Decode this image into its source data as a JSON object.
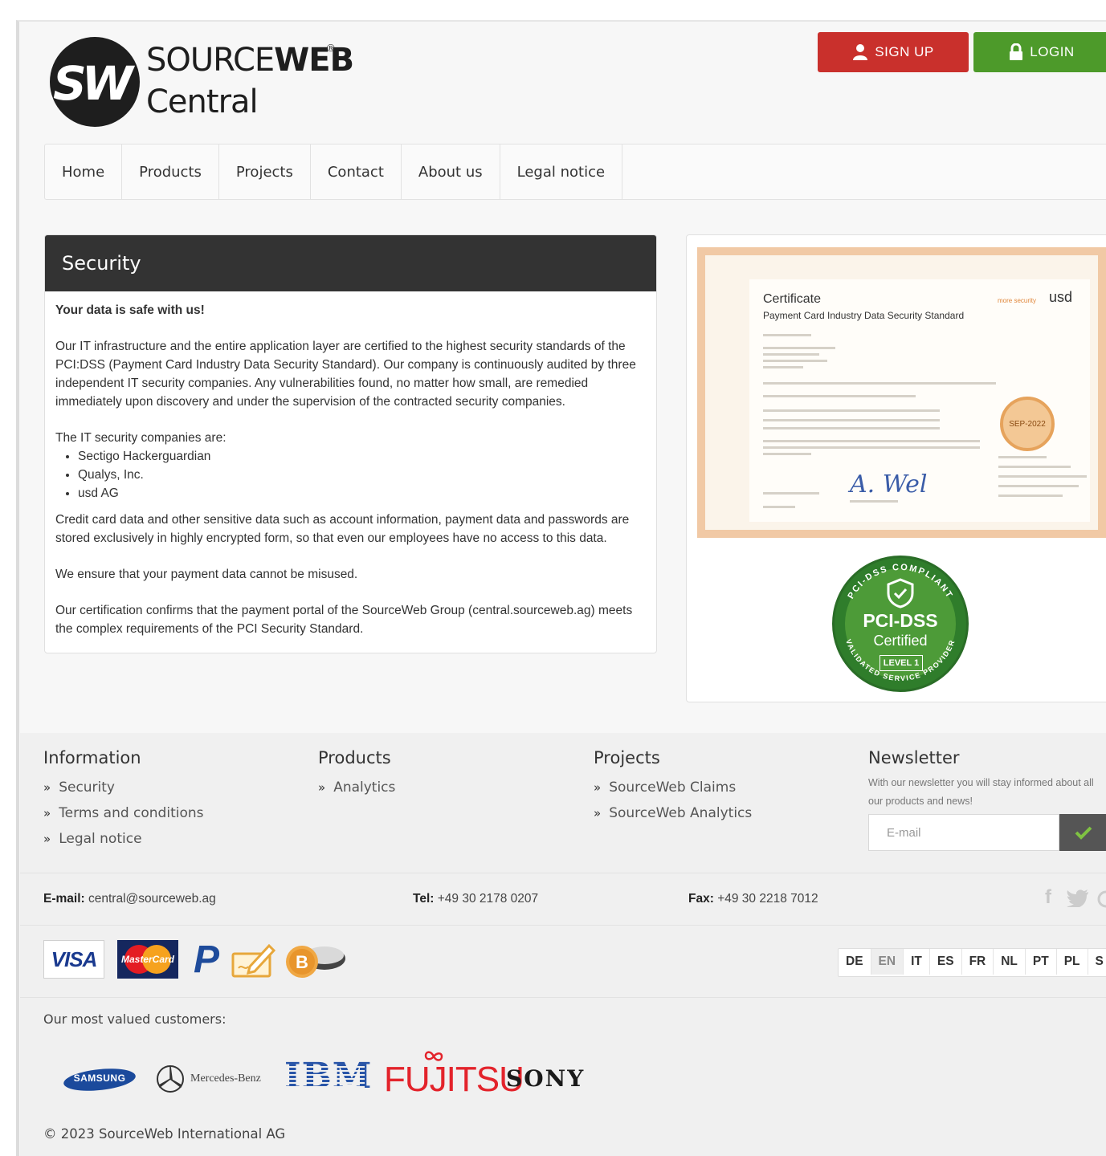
{
  "header": {
    "logo_mark": "SW",
    "logo_name_light": "SOURCE",
    "logo_name_bold": "WEB",
    "logo_reg": "®",
    "logo_sub": "Central",
    "signup_label": "SIGN UP",
    "login_label": "LOGIN"
  },
  "nav": {
    "items": [
      {
        "label": "Home"
      },
      {
        "label": "Products"
      },
      {
        "label": "Projects"
      },
      {
        "label": "Contact"
      },
      {
        "label": "About us"
      },
      {
        "label": "Legal notice"
      }
    ]
  },
  "security": {
    "title": "Security",
    "lead": "Your data is safe with us!",
    "p1": "Our IT infrastructure and the entire application layer are certified to the highest security standards of the PCI:DSS (Payment Card Industry Data Security Standard). Our company is continuously audited by three independent IT security companies. Any vulnerabilities found, no matter how small, are remedied immediately upon discovery and under the supervision of the contracted security companies.",
    "companies_intro": "The IT security companies are:",
    "companies": [
      "Sectigo Hackerguardian",
      "Qualys, Inc.",
      "usd AG"
    ],
    "p2": "Credit card data and other sensitive data such as account information, payment data and passwords are stored exclusively in highly encrypted form, so that even our employees have no access to this data.",
    "p3": "We ensure that your payment data cannot be misused.",
    "p4": "Our certification confirms that the payment portal of the SourceWeb Group (central.sourceweb.ag) meets the complex requirements of the PCI Security Standard."
  },
  "certificate": {
    "title": "Certificate",
    "subtitle": "Payment Card Industry Data Security Standard",
    "issuer_tagline": "more security",
    "issuer": "usd",
    "seal_date": "SEP-2022",
    "signature": "A. Wel"
  },
  "pci_badge": {
    "title": "PCI-DSS",
    "certified": "Certified",
    "level": "LEVEL 1",
    "ring_top": "PCI-DSS COMPLIANT",
    "ring_bottom": "VALIDATED SERVICE PROVIDER"
  },
  "footer": {
    "information": {
      "title": "Information",
      "links": [
        "Security",
        "Terms and conditions",
        "Legal notice"
      ]
    },
    "products": {
      "title": "Products",
      "links": [
        "Analytics"
      ]
    },
    "projects": {
      "title": "Projects",
      "links": [
        "SourceWeb Claims",
        "SourceWeb Analytics"
      ]
    },
    "newsletter": {
      "title": "Newsletter",
      "text": "With our newsletter you will stay informed about all our products and news!",
      "placeholder": "E-mail"
    },
    "contact": {
      "email_label": "E-mail:",
      "email": "central@sourceweb.ag",
      "tel_label": "Tel:",
      "tel": "+49 30 2178 0207",
      "fax_label": "Fax:",
      "fax": "+49 30 2218 7012"
    },
    "payments": {
      "visa": "VISA",
      "mastercard": "MasterCard",
      "paypal": "P"
    },
    "languages": [
      {
        "code": "DE",
        "active": false
      },
      {
        "code": "EN",
        "active": true
      },
      {
        "code": "IT",
        "active": false
      },
      {
        "code": "ES",
        "active": false
      },
      {
        "code": "FR",
        "active": false
      },
      {
        "code": "NL",
        "active": false
      },
      {
        "code": "PT",
        "active": false
      },
      {
        "code": "PL",
        "active": false
      },
      {
        "code": "S",
        "active": false
      }
    ],
    "customers_label": "Our most valued customers:",
    "customers": {
      "samsung": "SAMSUNG",
      "mercedes": "Mercedes-Benz",
      "ibm": "IBM",
      "fujitsu": "FUJITSU",
      "sony": "SONY"
    },
    "copyright": "© 2023 SourceWeb International AG"
  },
  "colors": {
    "signup": "#c9302c",
    "login": "#4d9a2a",
    "panel_header": "#333333",
    "pci_green": "#4d9b38"
  }
}
